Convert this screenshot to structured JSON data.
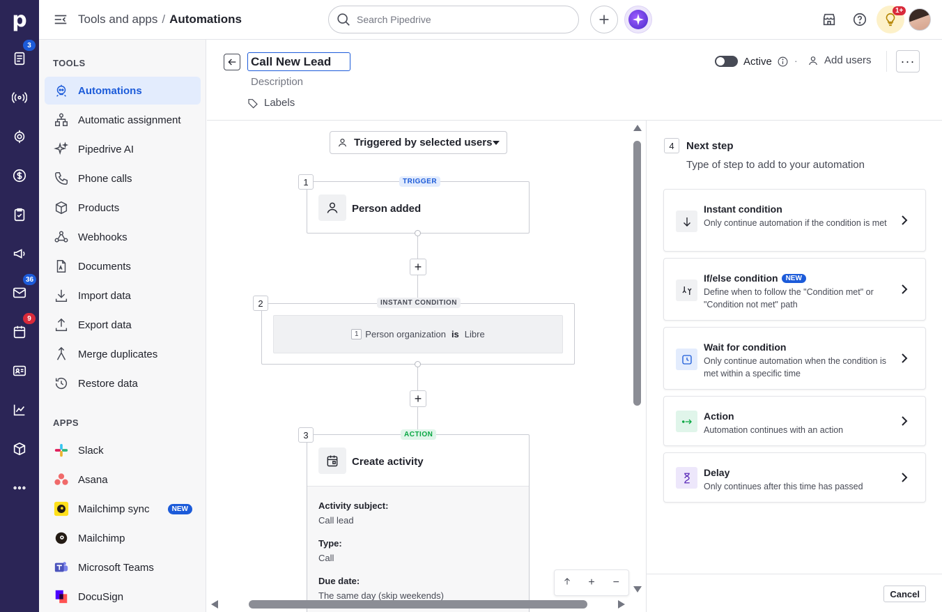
{
  "colors": {
    "rail_bg": "#2b2556",
    "accent": "#1c5bd9",
    "action_green": "#08a742",
    "badge_red": "#d92a3a"
  },
  "rail": {
    "logo": "p",
    "badges": {
      "leads": "3",
      "mail": "36",
      "calendar": "9"
    }
  },
  "topbar": {
    "crumb_parent": "Tools and apps",
    "crumb_sep": "/",
    "crumb_current": "Automations",
    "search_placeholder": "Search Pipedrive",
    "tips_badge": "1+"
  },
  "sidebar": {
    "tools_heading": "TOOLS",
    "tools": [
      {
        "label": "Automations",
        "icon": "automation-robot-icon"
      },
      {
        "label": "Automatic assignment",
        "icon": "assignment-icon"
      },
      {
        "label": "Pipedrive AI",
        "icon": "sparkle-icon"
      },
      {
        "label": "Phone calls",
        "icon": "phone-icon"
      },
      {
        "label": "Products",
        "icon": "box-icon"
      },
      {
        "label": "Webhooks",
        "icon": "webhook-icon"
      },
      {
        "label": "Documents",
        "icon": "document-icon"
      },
      {
        "label": "Import data",
        "icon": "import-icon"
      },
      {
        "label": "Export data",
        "icon": "export-icon"
      },
      {
        "label": "Merge duplicates",
        "icon": "merge-icon"
      },
      {
        "label": "Restore data",
        "icon": "restore-icon"
      }
    ],
    "apps_heading": "APPS",
    "apps": [
      {
        "label": "Slack",
        "icon": "slack-icon"
      },
      {
        "label": "Asana",
        "icon": "asana-icon"
      },
      {
        "label": "Mailchimp sync",
        "icon": "mailchimp-icon",
        "badge": "NEW"
      },
      {
        "label": "Mailchimp",
        "icon": "mailchimp-icon"
      },
      {
        "label": "Microsoft Teams",
        "icon": "teams-icon"
      },
      {
        "label": "DocuSign",
        "icon": "docusign-icon"
      }
    ]
  },
  "header": {
    "name_value": "Call New Lead",
    "description_placeholder": "Description",
    "labels": "Labels",
    "active_label": "Active",
    "active_sep": "·",
    "add_users": "Add users",
    "more": "···"
  },
  "canvas": {
    "trigger_select": "Triggered by selected users",
    "steps": [
      {
        "number": "1",
        "tag": "TRIGGER",
        "title": "Person added"
      },
      {
        "number": "2",
        "tag": "INSTANT CONDITION",
        "cond_index": "1",
        "cond_field": "Person organization",
        "cond_op": "is",
        "cond_value": "Libre"
      },
      {
        "number": "3",
        "tag": "ACTION",
        "title": "Create activity",
        "fields": [
          {
            "key": "Activity subject:",
            "value": "Call lead"
          },
          {
            "key": "Type:",
            "value": "Call"
          },
          {
            "key": "Due date:",
            "value": "The same day (skip weekends)"
          }
        ]
      }
    ],
    "add_step": "+",
    "zoom": {
      "plus": "+",
      "minus": "−"
    }
  },
  "next_step": {
    "number": "4",
    "title": "Next step",
    "subtitle": "Type of step to add to your automation",
    "options": [
      {
        "title": "Instant condition",
        "desc": "Only continue automation if the condition is met"
      },
      {
        "title": "If/else condition",
        "badge": "NEW",
        "desc": "Define when to follow the \"Condition met\" or \"Condition not met\" path"
      },
      {
        "title": "Wait for condition",
        "desc": "Only continue automation when the condition is met within a specific time"
      },
      {
        "title": "Action",
        "desc": "Automation continues with an action"
      },
      {
        "title": "Delay",
        "desc": "Only continues after this time has passed"
      }
    ],
    "cancel": "Cancel"
  }
}
